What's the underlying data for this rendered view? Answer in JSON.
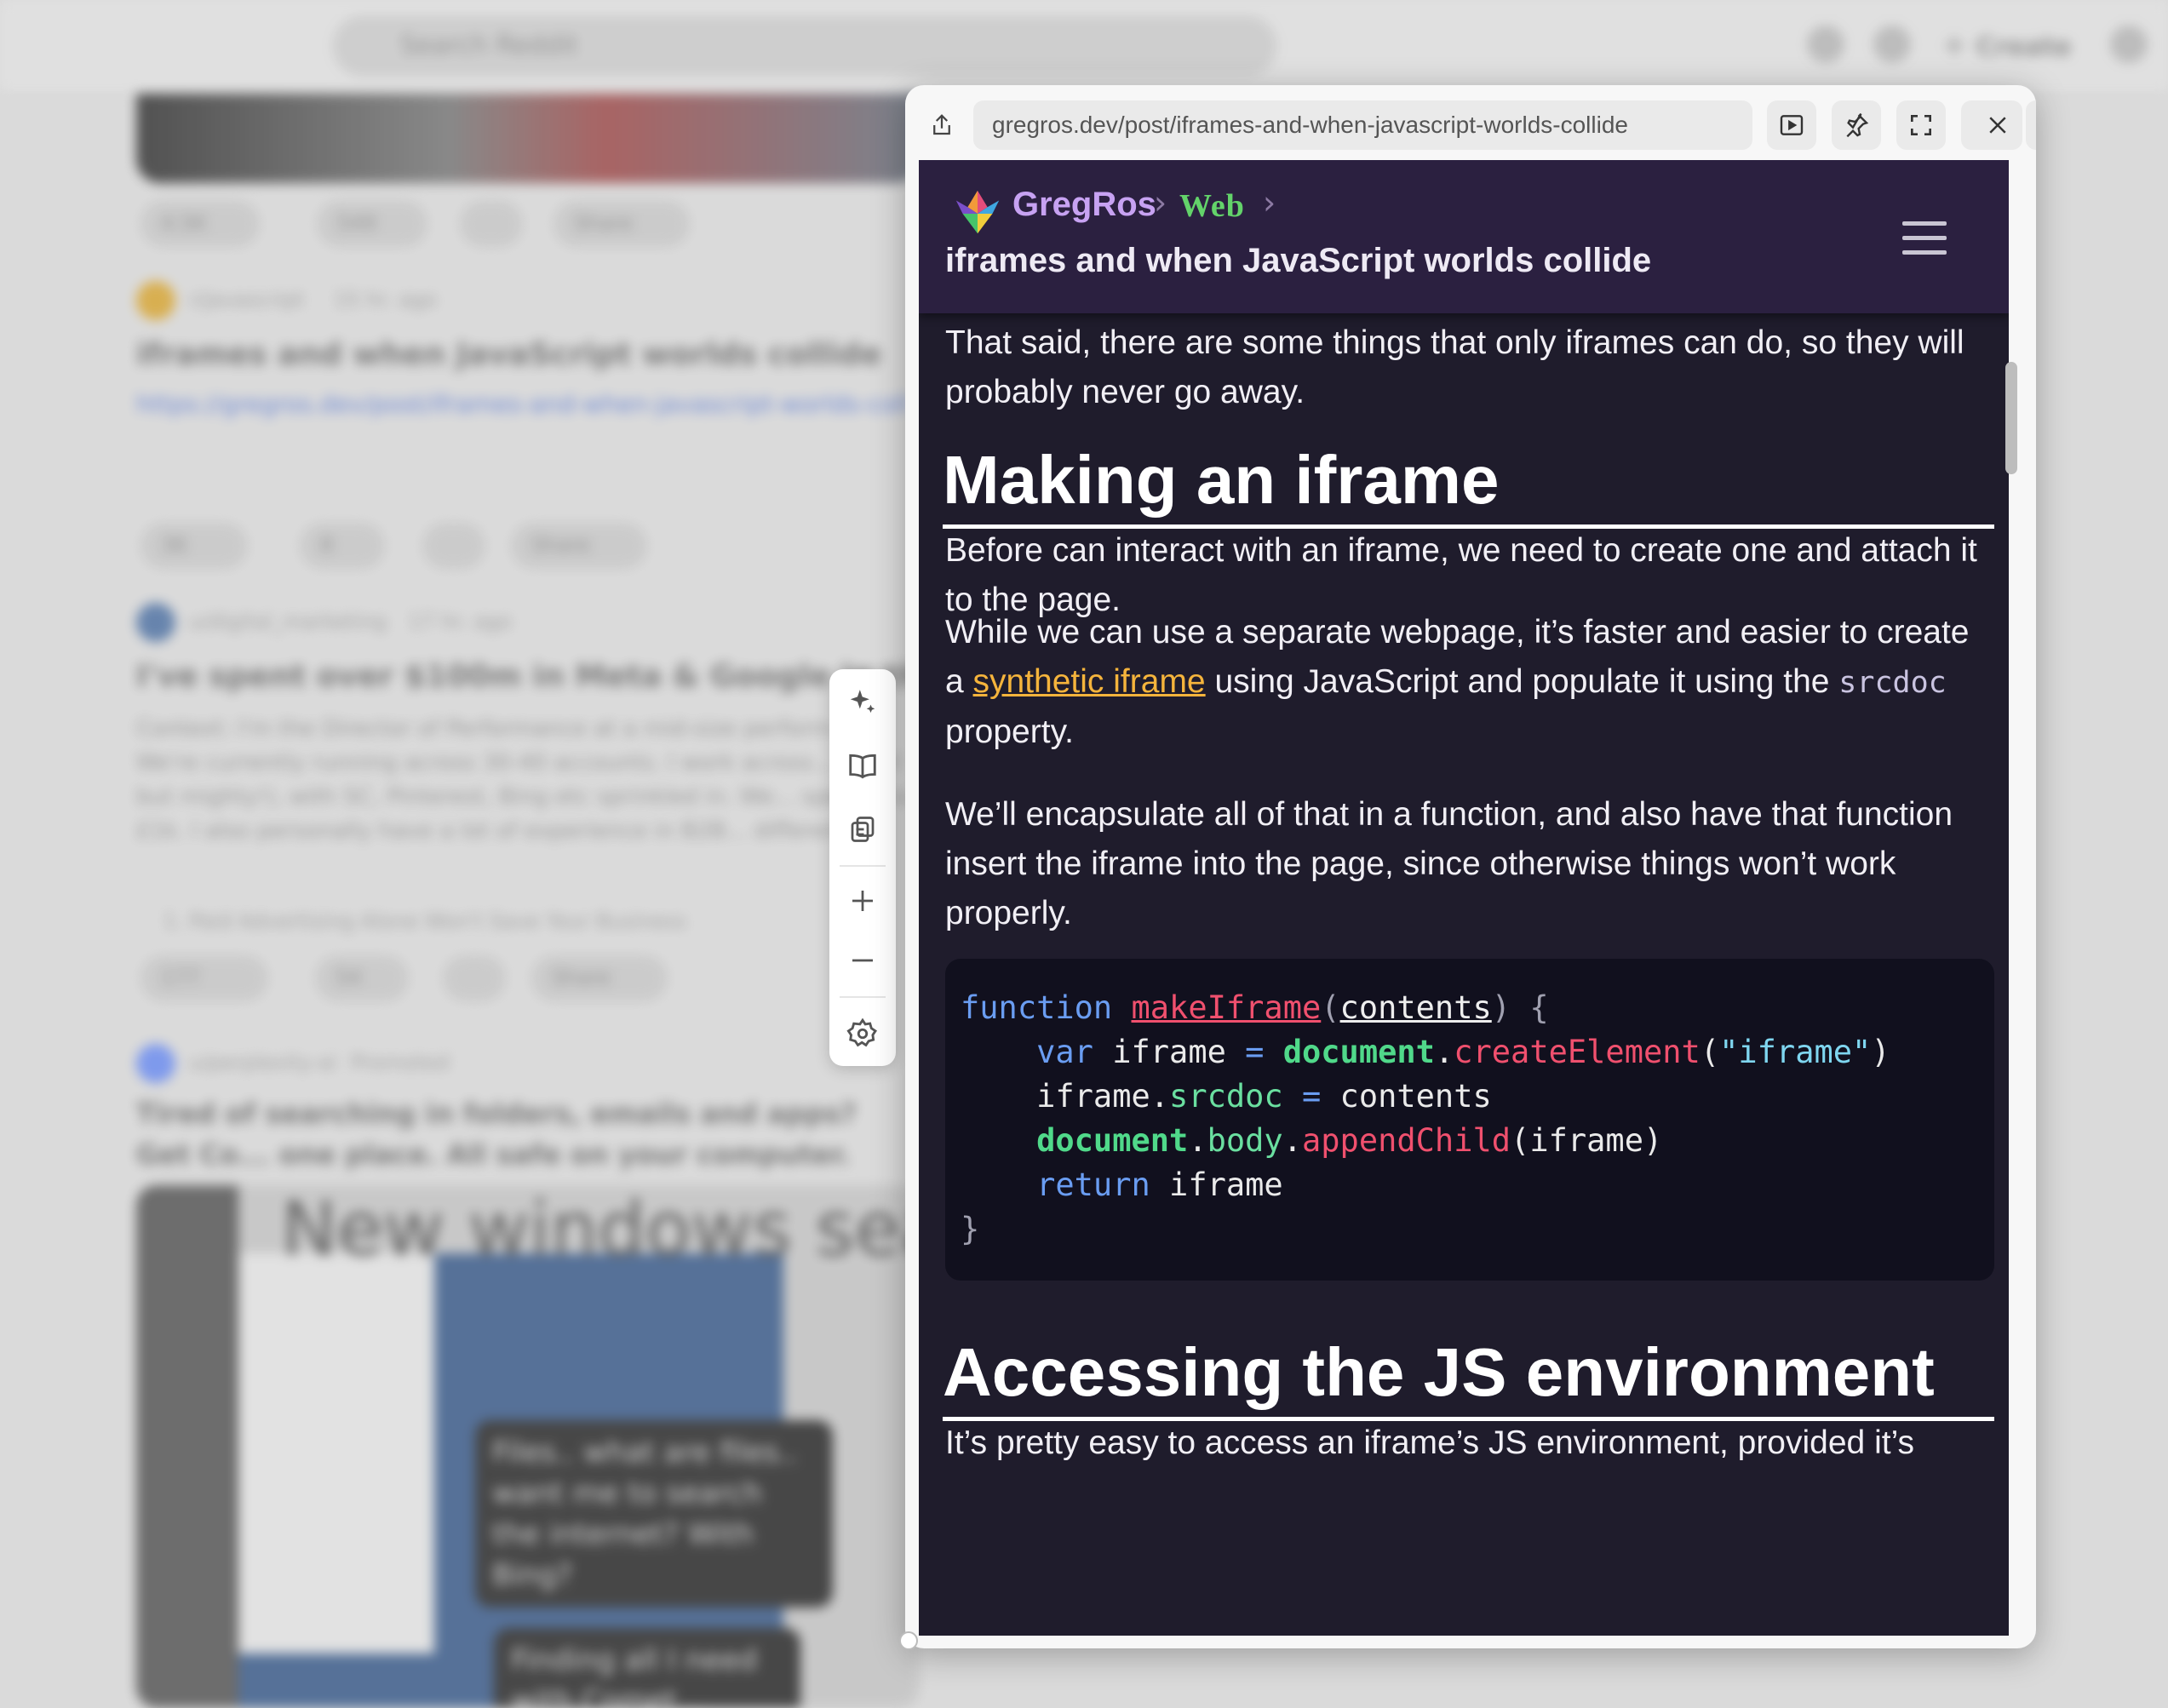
{
  "background": {
    "search_placeholder": "Search Reddit",
    "create_label": "Create",
    "posts": [
      {
        "author": "r/javascript",
        "time": "15 hr. ago",
        "title": "iframes and when JavaScript worlds collide",
        "link": "https://gregros.dev/post/iframes-and-when-javascript-worlds-coll",
        "votes": "36",
        "comments": "8",
        "share": "Share"
      },
      {
        "author": "u/digital_marketing",
        "time": "17 hr. ago",
        "title": "I've spent over $100m in Meta & Google in the last",
        "body": "Context: I'm the Director of Performance at a mid-size perform... We're currently running across 30-40 accounts. I work across... small but mighty!), with SC, Pinterest, Bing etc sprinkled in. We... spends to £1k. I also personally have a lot of experience in B2B... difference",
        "list_item": "1. Paid Advertising Alone Won't Save Your Business",
        "votes": "177",
        "comments": "54",
        "share": "Share"
      },
      {
        "author": "u/perplexity-ai",
        "time": "Promoted",
        "title": "Tired of searching in folders, emails and apps? Get Co... one place. All safe on your computer.",
        "ad_headline": "New windows sea",
        "bubble1": "Files.. what are files.. want me to search the internet? With Bing?",
        "bubble2": "Finding all I need with Comet..."
      }
    ],
    "top_post_votes": "4.5K",
    "top_post_comments": "549",
    "top_post_share": "Share"
  },
  "sidetools": {
    "items": [
      "sparkle-icon",
      "book-icon",
      "copy-icon",
      "plus-icon",
      "minus-icon",
      "gear-icon"
    ]
  },
  "popup": {
    "url": "gregros.dev/post/iframes-and-when-javascript-worlds-collide",
    "toolbar_icons": [
      "share-icon",
      "play-icon",
      "pin-icon",
      "expand-icon",
      "sidebar-icon",
      "close-icon"
    ]
  },
  "site": {
    "name": "GregRos",
    "section": "Web",
    "title": "iframes and when JavaScript worlds collide",
    "colors": {
      "header": "#2b2040",
      "page": "#1f1c2c",
      "section": "#63d36a",
      "link": "#f5b43c"
    }
  },
  "article": {
    "intro": "That said, there are some things that only iframes can do, so they will probably never go away.",
    "h_making": "Making an iframe",
    "p1": "Before can interact with an iframe, we need to create one and attach it to the page.",
    "p2_a": "While we can use a separate webpage, it’s faster and easier to create a ",
    "p2_link": "synthetic iframe",
    "p2_b": " using JavaScript and populate it using the ",
    "p2_code": "srcdoc",
    "p2_c": " property.",
    "p3": "We’ll encapsulate all of that in a function, and also have that function insert the iframe into the page, since otherwise things won’t work properly.",
    "code": {
      "kw_function": "function",
      "fn_name": "makeIframe",
      "arg": "contents",
      "kw_var": "var",
      "var_name": "iframe",
      "obj_document": "document",
      "m_create": "createElement",
      "str_iframe": "\"iframe\"",
      "prop_srcdoc": "srcdoc",
      "val_contents": "contents",
      "prop_body": "body",
      "m_append": "appendChild",
      "kw_return": "return"
    },
    "h_accessing": "Accessing the JS environment",
    "p4": "It’s pretty easy to access an iframe’s JS environment, provided it’s"
  }
}
